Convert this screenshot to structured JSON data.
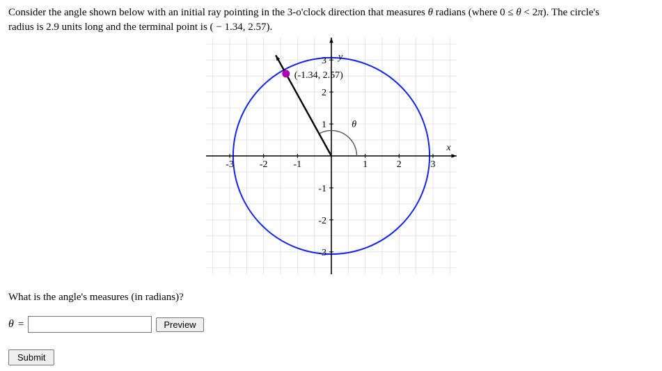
{
  "problem": {
    "line1_a": "Consider the angle shown below with an initial ray pointing in the 3-o'clock direction that measures ",
    "line1_b": " radians (where ",
    "line1_c": "). The circle's",
    "line2": "radius is 2.9 units long and the terminal point is ( − 1.34, 2.57).",
    "theta_var": "θ",
    "range_lhs": "0 ≤ ",
    "range_mid": " < 2",
    "range_pi": "π"
  },
  "question": "What is the angle's measures (in radians)?",
  "answer": {
    "label": "θ",
    "equals": "=",
    "value": "",
    "preview_label": "Preview"
  },
  "submit_label": "Submit",
  "chart_data": {
    "type": "diagram",
    "title": "",
    "radius": 2.9,
    "terminal_point": {
      "x": -1.34,
      "y": 2.57
    },
    "theta_hint_location": {
      "x": 0.6,
      "y": 0.9
    },
    "x_ticks": [
      -3,
      -2,
      -1,
      1,
      2,
      3
    ],
    "y_ticks": [
      -3,
      -2,
      -1,
      1,
      2,
      3
    ],
    "xlim": [
      -3.7,
      3.7
    ],
    "ylim": [
      -3.7,
      3.7
    ],
    "axis_labels": {
      "x": "x",
      "y": "y"
    },
    "point_label": "(-1.34, 2.57)",
    "theta_label": "θ"
  }
}
